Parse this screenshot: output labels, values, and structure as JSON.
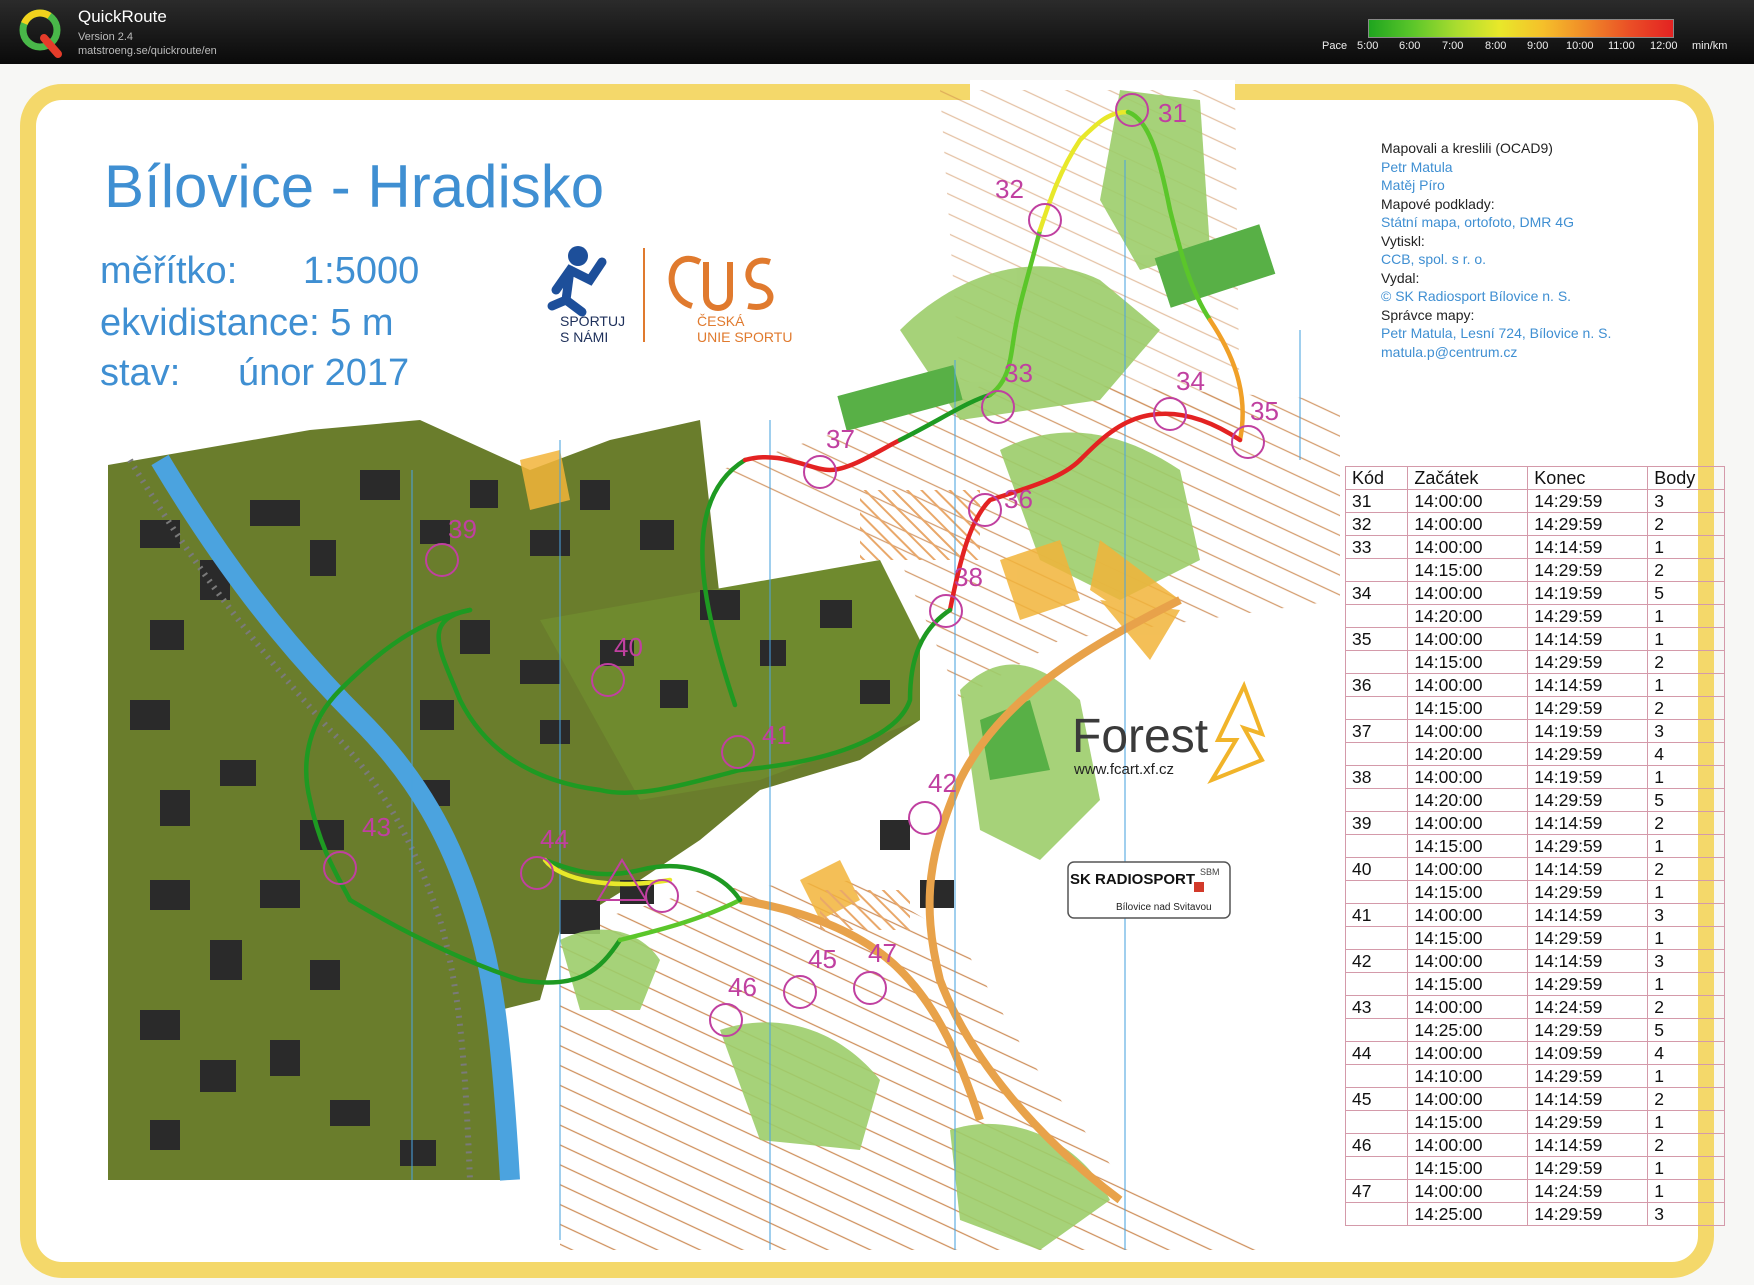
{
  "app": {
    "name": "QuickRoute",
    "version": "Version 2.4",
    "url": "matstroeng.se/quickroute/en"
  },
  "pace_scale": {
    "label": "Pace",
    "ticks": [
      "5:00",
      "6:00",
      "7:00",
      "8:00",
      "9:00",
      "10:00",
      "11:00",
      "12:00"
    ],
    "unit": "min/km",
    "colors": [
      "#1fa51f",
      "#5bc62a",
      "#a9dc2f",
      "#e8e82a",
      "#f5c02a",
      "#f08a28",
      "#ea4f26",
      "#e32222"
    ]
  },
  "map": {
    "title": "Bílovice - Hradisko",
    "scale_label": "měřítko:",
    "scale_value": "1:5000",
    "contour_label": "ekvidistance: 5 m",
    "state_label": "stav:",
    "state_value": "únor 2017",
    "logos": {
      "sportuj_line1": "SPORTUJ",
      "sportuj_line2": "S NÁMI",
      "cus_line1": "ČESKÁ",
      "cus_line2": "UNIE SPORTU",
      "forest": "Forest",
      "forest_url": "www.fcart.xf.cz",
      "radiosport": "SK RADIOSPORT",
      "radiosport_sub": "Bílovice nad Svitavou",
      "radiosport_badge": "SBM"
    },
    "credits": [
      {
        "heading": "Mapovali a kreslili (OCAD9)",
        "lines": [
          "Petr Matula",
          "Matěj Píro"
        ]
      },
      {
        "heading": "Mapové podklady:",
        "lines": [
          "Státní mapa, ortofoto, DMR 4G"
        ]
      },
      {
        "heading": "Vytiskl:",
        "lines": [
          "CCB, spol. s r. o."
        ]
      },
      {
        "heading": "Vydal:",
        "lines": [
          "© SK Radiosport Bílovice n. S."
        ]
      },
      {
        "heading": "Správce mapy:",
        "lines": [
          "Petr Matula, Lesní 724, Bílovice n. S.",
          "matula.p@centrum.cz"
        ]
      }
    ],
    "controls": [
      "31",
      "32",
      "33",
      "34",
      "35",
      "36",
      "37",
      "38",
      "39",
      "40",
      "41",
      "42",
      "43",
      "44",
      "45",
      "46",
      "47"
    ],
    "table": {
      "headers": [
        "Kód",
        "Začátek",
        "Konec",
        "Body"
      ],
      "rows": [
        [
          "31",
          "14:00:00",
          "14:29:59",
          "3"
        ],
        [
          "32",
          "14:00:00",
          "14:29:59",
          "2"
        ],
        [
          "33",
          "14:00:00",
          "14:14:59",
          "1"
        ],
        [
          "",
          "14:15:00",
          "14:29:59",
          "2"
        ],
        [
          "34",
          "14:00:00",
          "14:19:59",
          "5"
        ],
        [
          "",
          "14:20:00",
          "14:29:59",
          "1"
        ],
        [
          "35",
          "14:00:00",
          "14:14:59",
          "1"
        ],
        [
          "",
          "14:15:00",
          "14:29:59",
          "2"
        ],
        [
          "36",
          "14:00:00",
          "14:14:59",
          "1"
        ],
        [
          "",
          "14:15:00",
          "14:29:59",
          "2"
        ],
        [
          "37",
          "14:00:00",
          "14:19:59",
          "3"
        ],
        [
          "",
          "14:20:00",
          "14:29:59",
          "4"
        ],
        [
          "38",
          "14:00:00",
          "14:19:59",
          "1"
        ],
        [
          "",
          "14:20:00",
          "14:29:59",
          "5"
        ],
        [
          "39",
          "14:00:00",
          "14:14:59",
          "2"
        ],
        [
          "",
          "14:15:00",
          "14:29:59",
          "1"
        ],
        [
          "40",
          "14:00:00",
          "14:14:59",
          "2"
        ],
        [
          "",
          "14:15:00",
          "14:29:59",
          "1"
        ],
        [
          "41",
          "14:00:00",
          "14:14:59",
          "3"
        ],
        [
          "",
          "14:15:00",
          "14:29:59",
          "1"
        ],
        [
          "42",
          "14:00:00",
          "14:14:59",
          "3"
        ],
        [
          "",
          "14:15:00",
          "14:29:59",
          "1"
        ],
        [
          "43",
          "14:00:00",
          "14:24:59",
          "2"
        ],
        [
          "",
          "14:25:00",
          "14:29:59",
          "5"
        ],
        [
          "44",
          "14:00:00",
          "14:09:59",
          "4"
        ],
        [
          "",
          "14:10:00",
          "14:29:59",
          "1"
        ],
        [
          "45",
          "14:00:00",
          "14:14:59",
          "2"
        ],
        [
          "",
          "14:15:00",
          "14:29:59",
          "1"
        ],
        [
          "46",
          "14:00:00",
          "14:14:59",
          "2"
        ],
        [
          "",
          "14:15:00",
          "14:29:59",
          "1"
        ],
        [
          "47",
          "14:00:00",
          "14:24:59",
          "1"
        ],
        [
          "",
          "14:25:00",
          "14:29:59",
          "3"
        ]
      ]
    }
  }
}
